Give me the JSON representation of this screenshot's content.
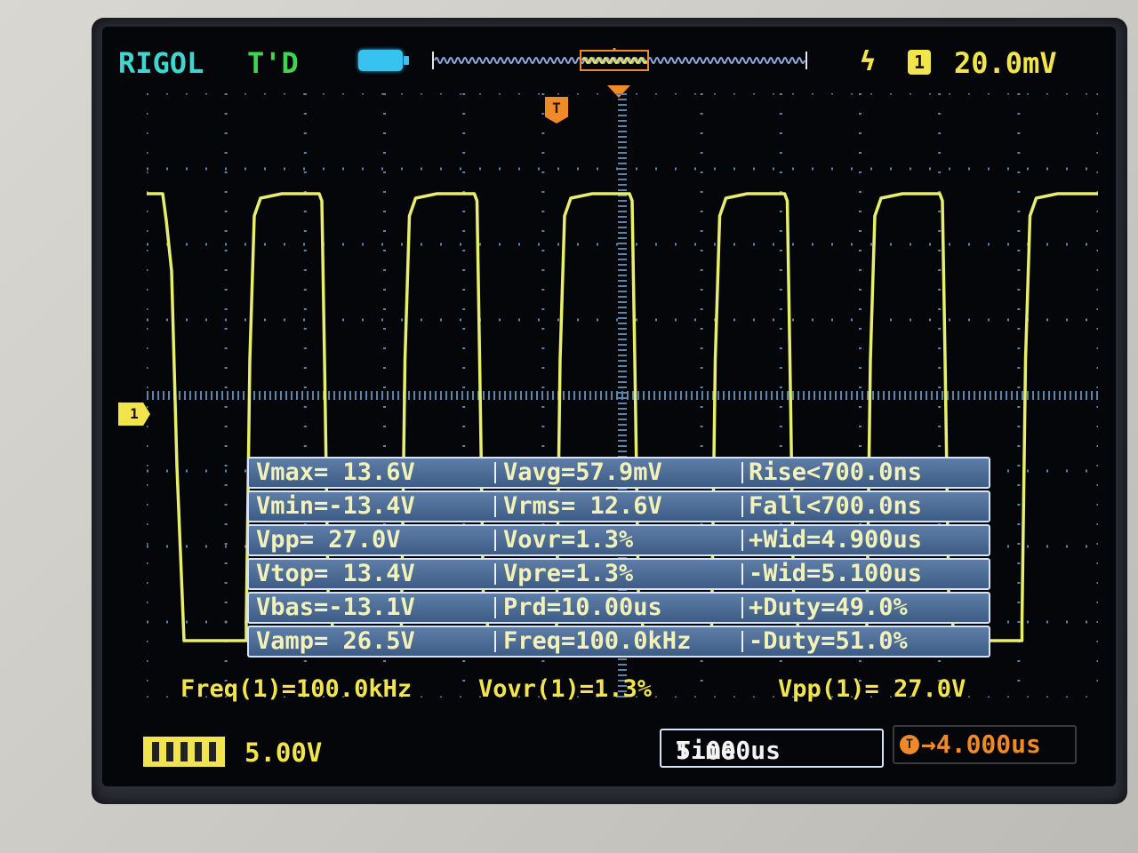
{
  "header": {
    "brand": "RIGOL",
    "trigger_status": "T'D",
    "trigger_edge_icon": "rising-edge-icon",
    "trigger_channel": "1",
    "trigger_level": "20.0mV",
    "trigger_marker": "T",
    "colors": {
      "brand": "#3fd6d0",
      "status": "#3fd64f",
      "channel1": "#f2e44d",
      "trigger": "#f08a28",
      "battery": "#38c2f0"
    }
  },
  "screen": {
    "channel_marker": "1"
  },
  "measurements": {
    "rows": [
      [
        "Vmax= 13.6V",
        "Vavg=57.9mV",
        "Rise<700.0ns"
      ],
      [
        "Vmin=-13.4V",
        "Vrms= 12.6V",
        "Fall<700.0ns"
      ],
      [
        "Vpp= 27.0V",
        "Vovr=1.3%",
        "+Wid=4.900us"
      ],
      [
        "Vtop= 13.4V",
        "Vpre=1.3%",
        "-Wid=5.100us"
      ],
      [
        "Vbas=-13.1V",
        "Prd=10.00us",
        "+Duty=49.0%"
      ],
      [
        "Vamp= 26.5V",
        "Freq=100.0kHz",
        "-Duty=51.0%"
      ]
    ]
  },
  "summary": {
    "freq": "Freq(1)=100.0kHz",
    "vovr": "Vovr(1)=1.3%",
    "vpp": "Vpp(1)= 27.0V"
  },
  "footer": {
    "channel_scale": "5.00V",
    "time_label": "Time",
    "timebase": "5.000us",
    "delay_icon": "T",
    "delay": "→4.000us"
  }
}
